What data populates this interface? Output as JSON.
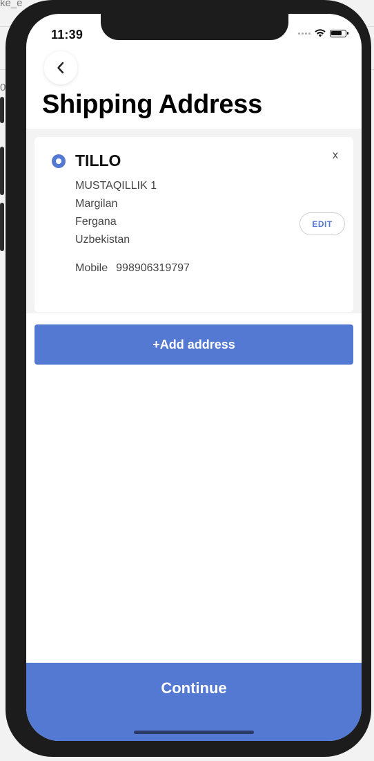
{
  "background": {
    "partial_text_top": "ke_e",
    "partial_text_left": "0"
  },
  "status_bar": {
    "time": "11:39",
    "icons": [
      "signal-dots-icon",
      "wifi-icon",
      "battery-icon"
    ]
  },
  "header": {
    "back_icon": "chevron-left-icon",
    "title": "Shipping Address"
  },
  "address_card": {
    "selected": true,
    "name": "TILLO",
    "close_label": "x",
    "lines": [
      "MUSTAQILLIK 1",
      "Margilan",
      "Fergana",
      "Uzbekistan"
    ],
    "mobile_label": "Mobile",
    "mobile_number": "998906319797",
    "edit_label": "EDIT"
  },
  "actions": {
    "add_address_label": "+Add address",
    "continue_label": "Continue"
  },
  "colors": {
    "accent": "#5479d3",
    "background_gray": "#f3f3f3"
  }
}
